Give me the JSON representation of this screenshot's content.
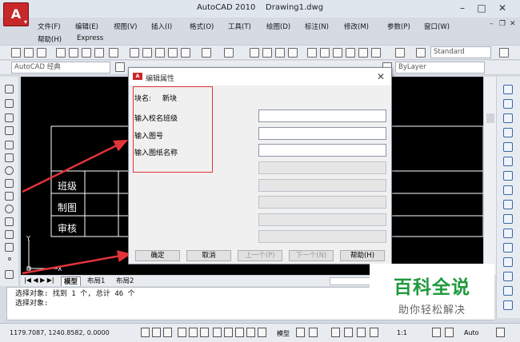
{
  "window": {
    "title": "AutoCAD 2010",
    "document": "Drawing1.dwg",
    "app_logo": "A"
  },
  "menu": {
    "row1": [
      "文件(F)",
      "编辑(E)",
      "视图(V)",
      "插入(I)",
      "格式(O)",
      "工具(T)",
      "绘图(D)",
      "标注(N)",
      "修改(M)",
      "参数(P)",
      "窗口(W)"
    ],
    "row2": [
      "帮助(H)",
      "Express"
    ]
  },
  "toolbar": {
    "style_select": "Standard",
    "workspace_select": "AutoCAD 经典",
    "layer_select": "ByLayer"
  },
  "drawing": {
    "table_rows": [
      "班级",
      "制图",
      "审核"
    ],
    "ucs_y": "Y",
    "ucs_x": "X"
  },
  "layout_tabs": {
    "tabs": [
      "模型",
      "布局1",
      "布局2"
    ]
  },
  "command_line": {
    "lines": [
      "选择对象: 找到 1 个, 总计 46 个",
      "选择对象:"
    ]
  },
  "status_bar": {
    "coordinates": "1179.7087, 1240.8582, 0.0000",
    "model_label": "模型",
    "scale": "1:1",
    "auto_label": "Auto"
  },
  "dialog": {
    "title": "编辑属性",
    "block_name_label": "块名:",
    "block_name_value": "新块",
    "fields": [
      {
        "label": "输入校名班级",
        "value": ""
      },
      {
        "label": "输入图号",
        "value": ""
      },
      {
        "label": "输入图纸名称",
        "value": ""
      }
    ],
    "buttons": {
      "ok": "确定",
      "cancel": "取消",
      "prev": "上一个(P)",
      "next": "下一个(N)",
      "help": "帮助(H)"
    }
  },
  "watermark": {
    "line1": "百科全说",
    "line2": "助你轻松解决"
  },
  "colors": {
    "canvas": "#000000",
    "annotation_red": "#e0343a",
    "watermark_green": "#1f9a3d",
    "autocad_red": "#c8282a"
  }
}
